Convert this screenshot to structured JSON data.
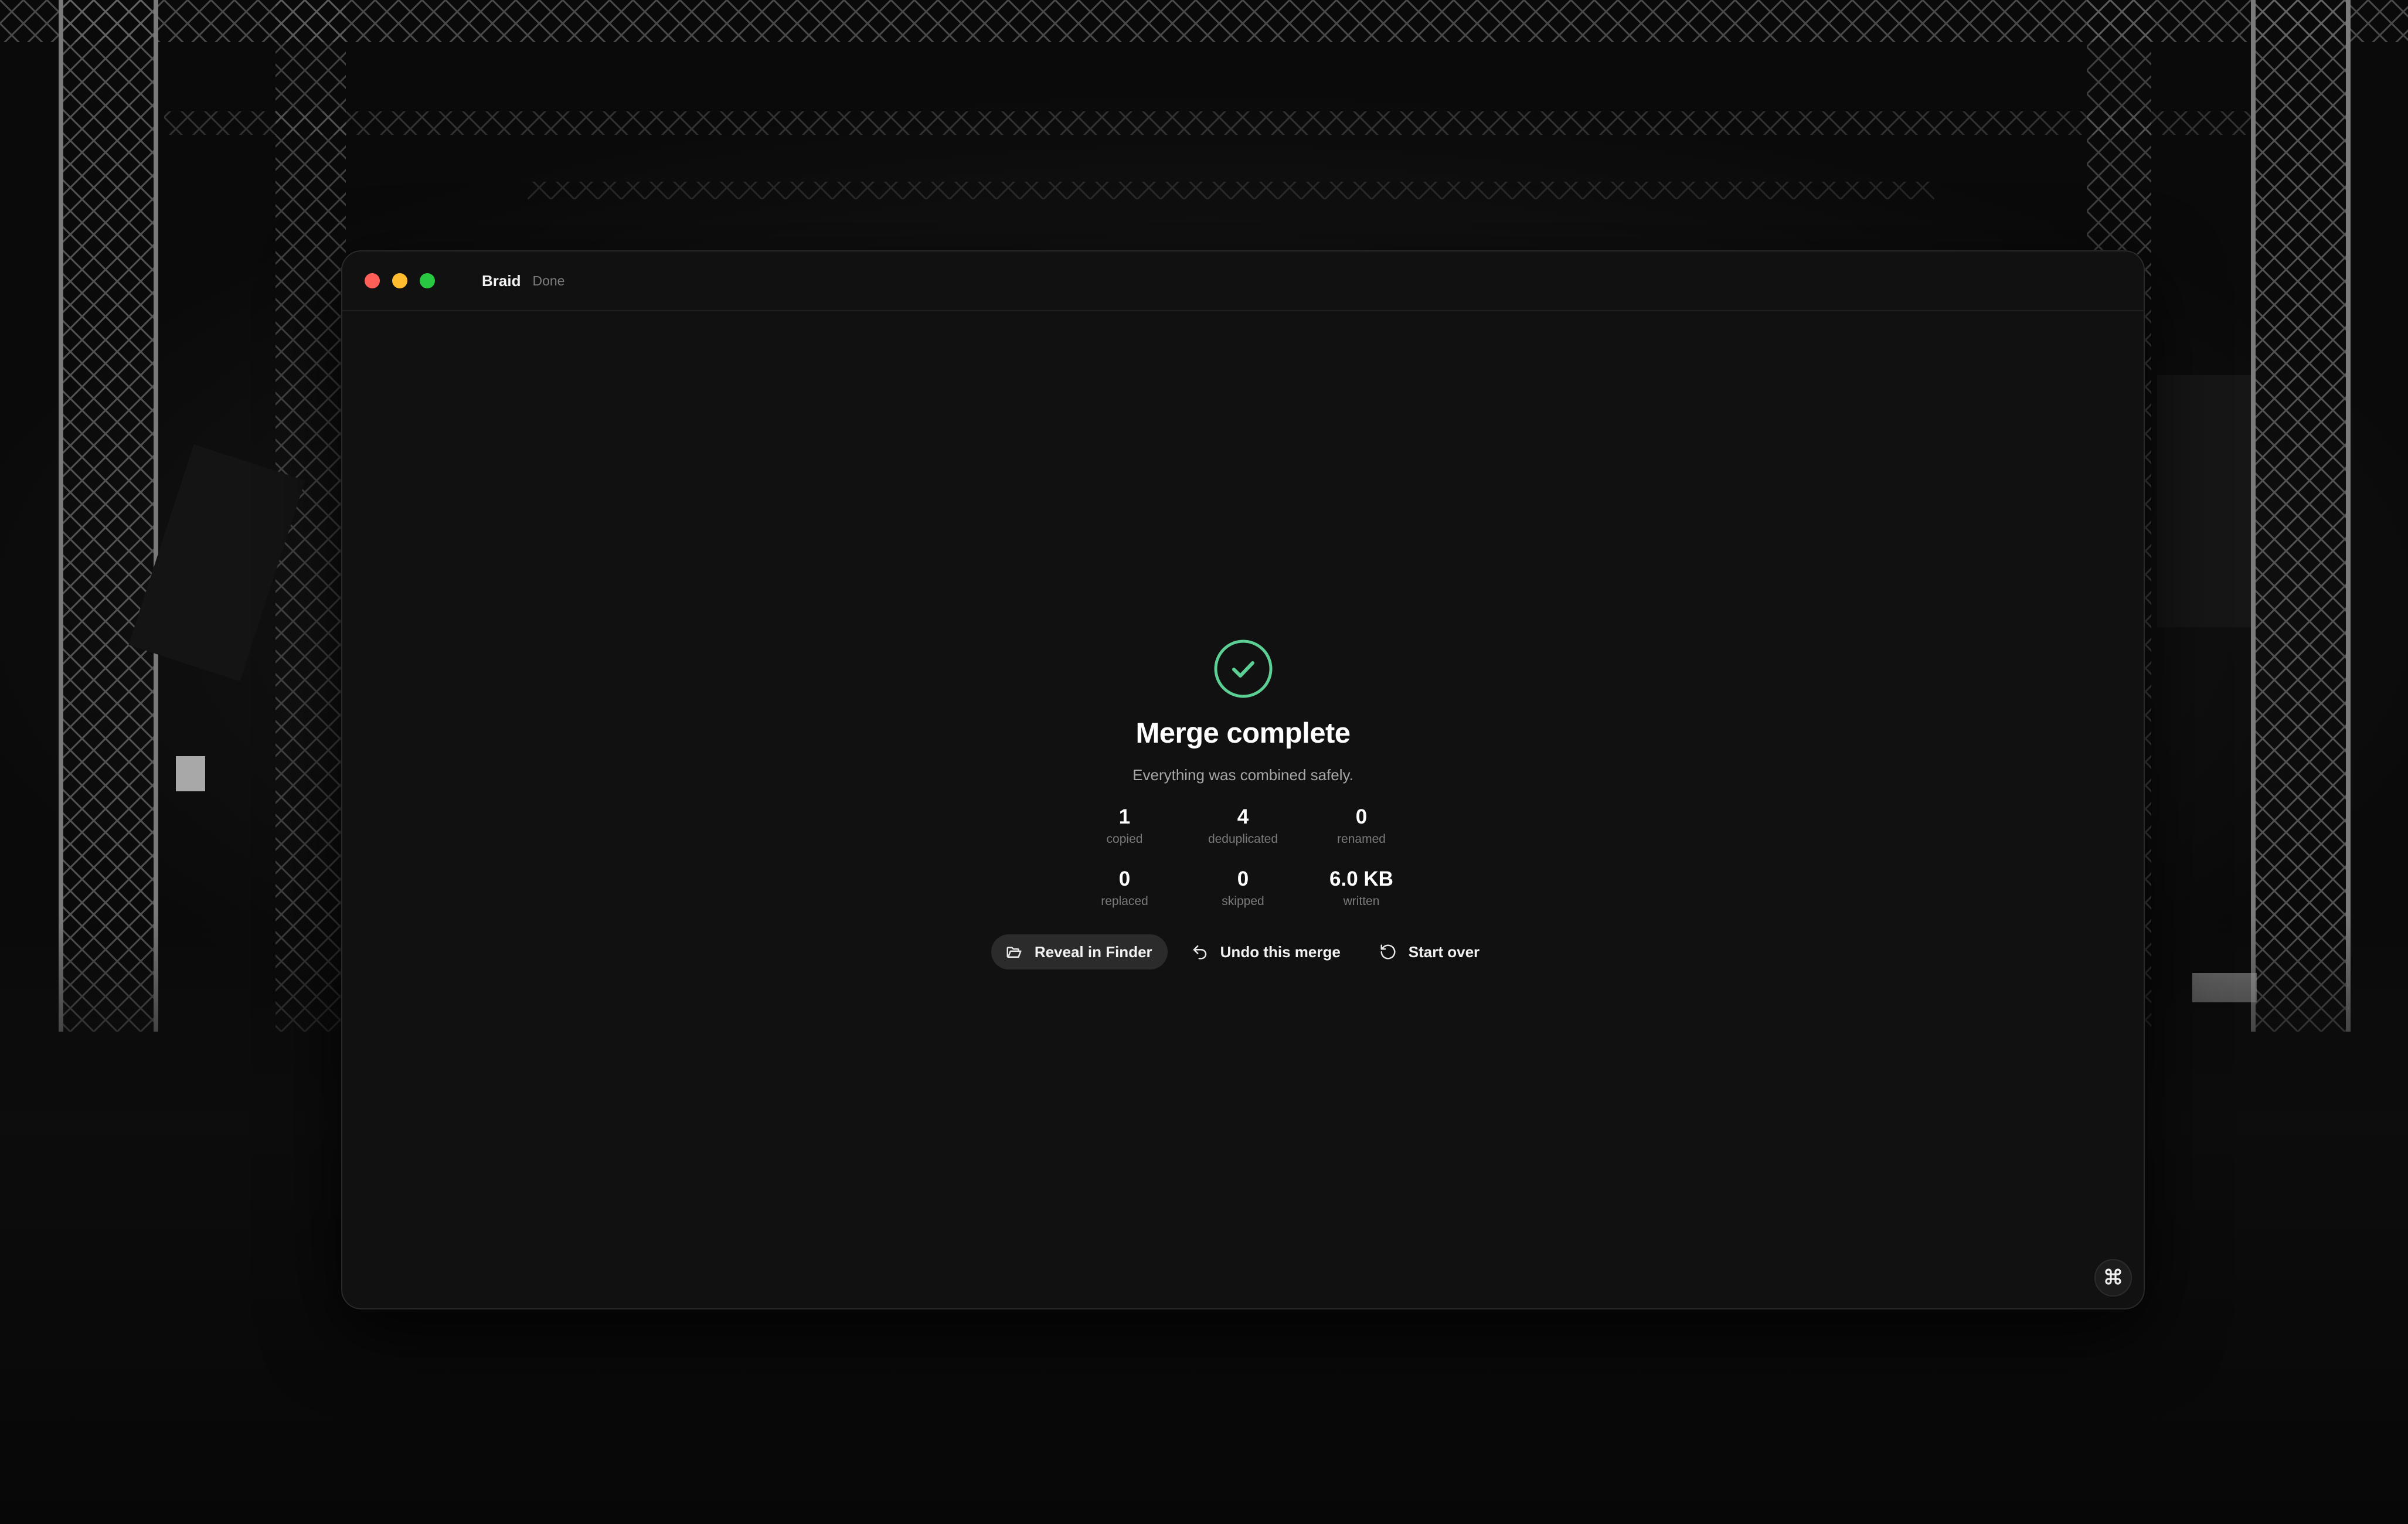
{
  "app": {
    "title": "Braid",
    "status": "Done"
  },
  "result": {
    "icon": "check-circle-icon",
    "accent_color": "#5ccf94",
    "headline": "Merge complete",
    "subline": "Everything was combined safely."
  },
  "stats": [
    {
      "value": "1",
      "label": "copied"
    },
    {
      "value": "4",
      "label": "deduplicated"
    },
    {
      "value": "0",
      "label": "renamed"
    },
    {
      "value": "0",
      "label": "replaced"
    },
    {
      "value": "0",
      "label": "skipped"
    },
    {
      "value": "6.0 KB",
      "label": "written"
    }
  ],
  "actions": {
    "reveal": {
      "label": "Reveal in Finder",
      "icon": "folder-open-icon"
    },
    "undo": {
      "label": "Undo this merge",
      "icon": "undo-arrow-icon"
    },
    "restart": {
      "label": "Start over",
      "icon": "rotate-ccw-icon"
    }
  },
  "corner": {
    "icon": "command-icon"
  },
  "colors": {
    "window_bg": "#111111",
    "traffic_close": "#ff5f57",
    "traffic_minimize": "#febc2e",
    "traffic_zoom": "#28c840"
  }
}
